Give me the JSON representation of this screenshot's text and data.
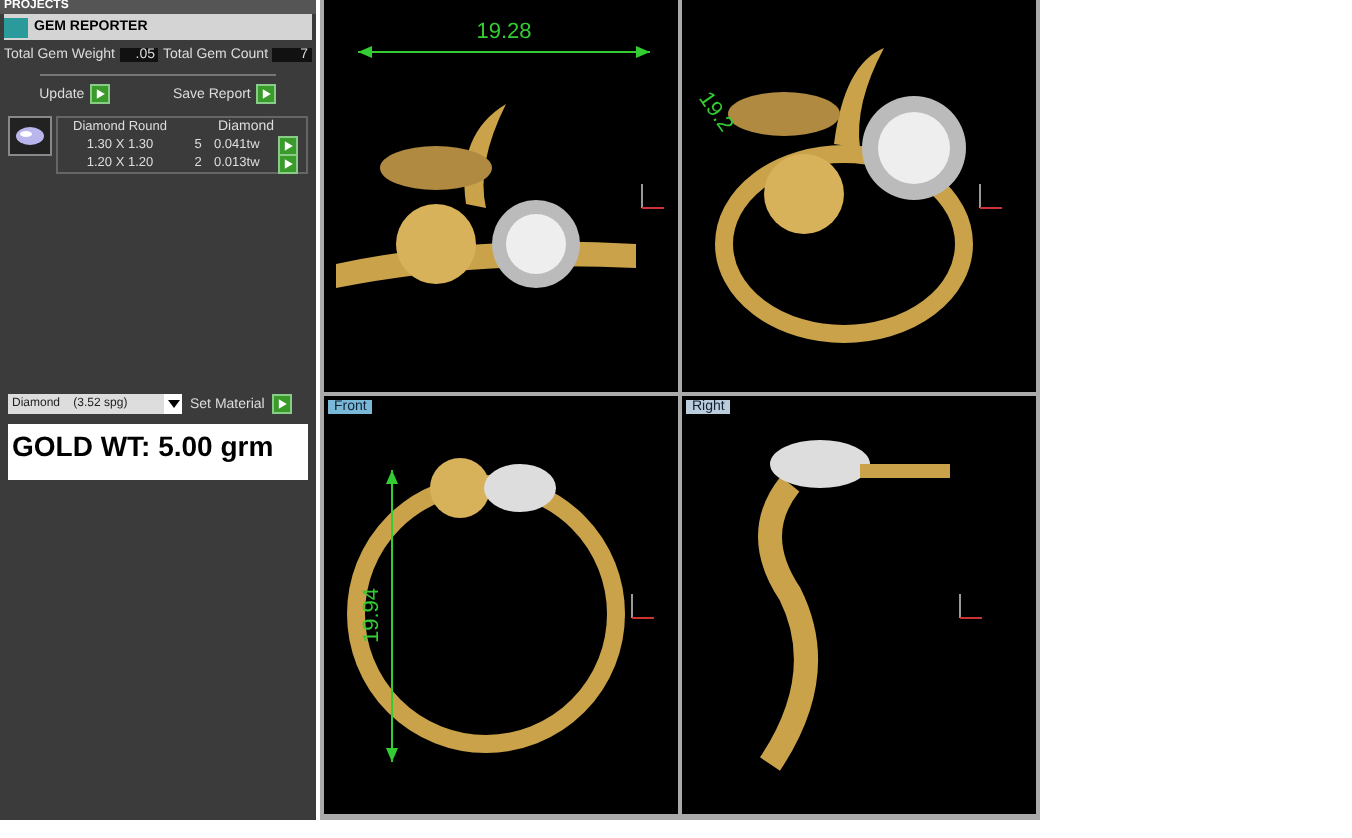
{
  "panel": {
    "header": "PROJECTS",
    "title": "GEM REPORTER",
    "stats": [
      {
        "label": "Total Gem Weight",
        "value": ".05"
      },
      {
        "label": "Total Gem Count",
        "value": "7"
      }
    ],
    "actions": [
      "Update",
      "Save Report"
    ],
    "gem_table": {
      "columns": [
        "Diamond Round",
        "Diamond"
      ],
      "rows": [
        {
          "size": "1.30 X 1.30",
          "count": "5",
          "weight": "0.041tw"
        },
        {
          "size": "1.20 X 1.20",
          "count": "2",
          "weight": "0.013tw"
        }
      ]
    },
    "material": {
      "value": "Diamond    (3.52 spg)",
      "button": "Set Material"
    },
    "note": "GOLD WT: 5.00 grm"
  },
  "viewports": [
    {
      "kind": "top",
      "dimension": "19.28"
    },
    {
      "kind": "perspective",
      "dimension": "19.2"
    },
    {
      "kind": "front",
      "label": "Front",
      "dimension": "19.94"
    },
    {
      "kind": "right",
      "label": "Right"
    }
  ]
}
